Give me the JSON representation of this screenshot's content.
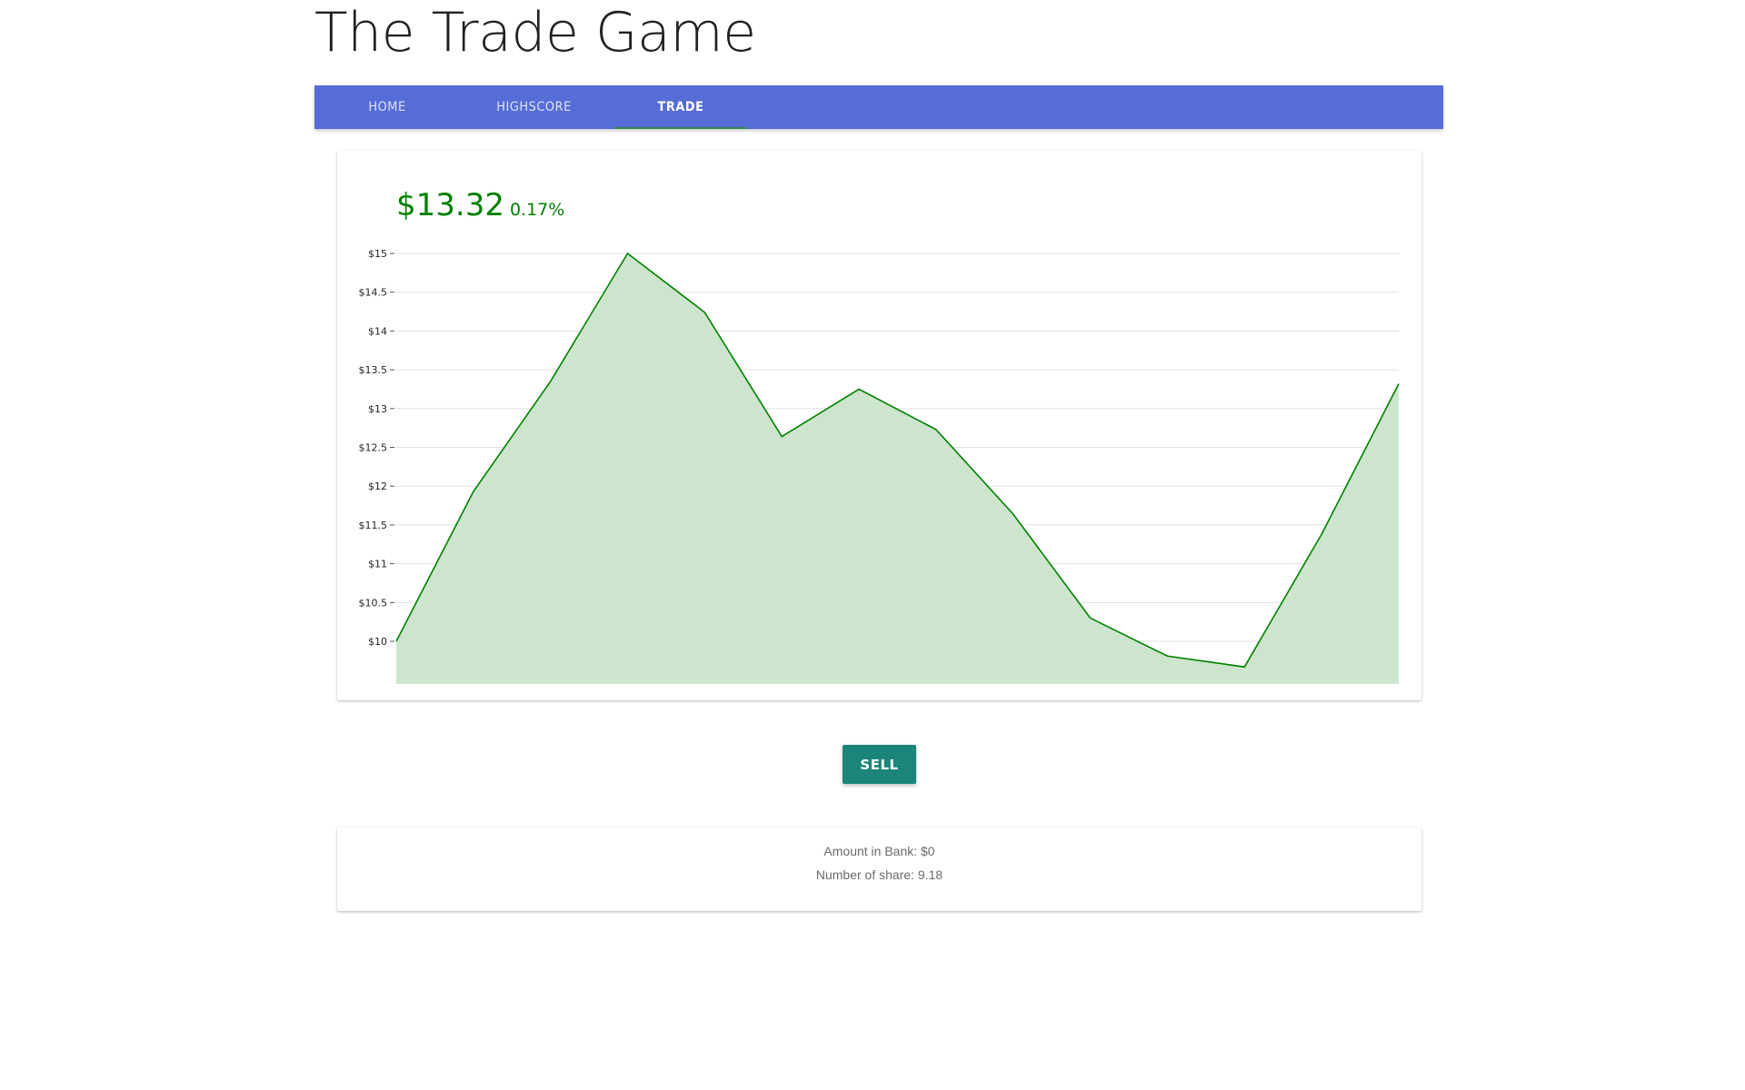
{
  "header": {
    "title": "The Trade Game"
  },
  "nav": {
    "tabs": [
      {
        "label": "HOME"
      },
      {
        "label": "HIGHSCORE"
      },
      {
        "label": "TRADE",
        "active": true
      }
    ]
  },
  "ticker": {
    "price": "$13.32",
    "change": "0.17%",
    "color": "#008000"
  },
  "chart_data": {
    "type": "area",
    "x": [
      0,
      1,
      2,
      3,
      4,
      5,
      6,
      7,
      8,
      9,
      10,
      11,
      12,
      13,
      14
    ],
    "values": [
      10.0,
      11.93,
      13.35,
      15.0,
      14.24,
      12.64,
      13.25,
      12.73,
      11.64,
      10.3,
      9.81,
      9.67,
      11.38,
      13.32
    ],
    "yticks": [
      10,
      10.5,
      11,
      11.5,
      12,
      12.5,
      13,
      13.5,
      14,
      14.5,
      15
    ],
    "ytick_labels": [
      "$10",
      "$10.5",
      "$11",
      "$11.5",
      "$12",
      "$12.5",
      "$13",
      "$13.5",
      "$14",
      "$14.5",
      "$15"
    ],
    "ylim": [
      9.45,
      15
    ],
    "line_color": "#008000",
    "fill_color": "#cce5cc",
    "grid": true,
    "title": "",
    "xlabel": "",
    "ylabel": ""
  },
  "actions": {
    "sell_label": "SELL",
    "sell_color": "#1b8579"
  },
  "account": {
    "bank_text": "Amount in Bank: $0",
    "shares_text": "Number of share: 9.18"
  }
}
